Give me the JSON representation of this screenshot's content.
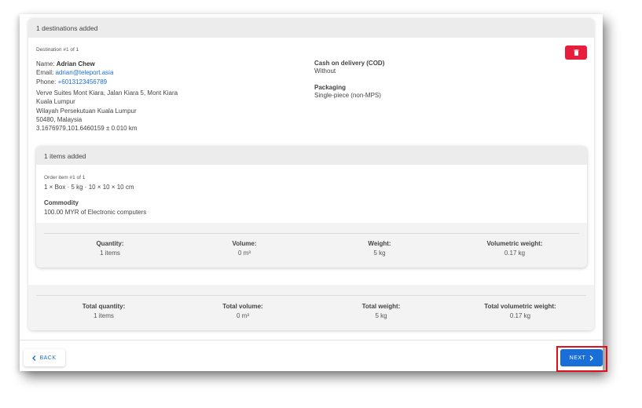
{
  "destinations": {
    "header": "1 destinations added",
    "item_label": "Destination #1 of 1",
    "contact": {
      "name_label": "Name:",
      "name": "Adrian Chew",
      "email_label": "Email:",
      "email": "adrian@teleport.asia",
      "phone_label": "Phone:",
      "phone": "+6013123456789"
    },
    "address_lines": [
      "Verve Suites Mont Kiara, Jalan Kiara 5, Mont Kiara",
      "Kuala Lumpur",
      "Wilayah Persekutuan Kuala Lumpur",
      "50480, Malaysia",
      "3.1676979,101.6460159 ± 0.010 km"
    ],
    "cod_label": "Cash on delivery (COD)",
    "cod_value": "Without",
    "packaging_label": "Packaging",
    "packaging_value": "Single-piece (non-MPS)",
    "delete_icon": "trash-icon",
    "delete_color": "#e81c3c"
  },
  "items": {
    "header": "1 items added",
    "item_label": "Order item #1 of 1",
    "item_desc": "1 × Box · 5 kg · 10 × 10 × 10 cm",
    "commodity_label": "Commodity",
    "commodity_value": "100.00 MYR of Electronic computers",
    "summary": [
      {
        "label": "Quantity:",
        "value": "1 items"
      },
      {
        "label": "Volume:",
        "value": "0 m³"
      },
      {
        "label": "Weight:",
        "value": "5 kg"
      },
      {
        "label": "Volumetric weight:",
        "value": "0.17 kg"
      }
    ]
  },
  "totals": [
    {
      "label": "Total quantity:",
      "value": "1 items"
    },
    {
      "label": "Total volume:",
      "value": "0 m³"
    },
    {
      "label": "Total weight:",
      "value": "5 kg"
    },
    {
      "label": "Total volumetric weight:",
      "value": "0.17 kg"
    }
  ],
  "footer": {
    "back_label": "BACK",
    "next_label": "NEXT",
    "accent_color": "#1a6ed8"
  }
}
